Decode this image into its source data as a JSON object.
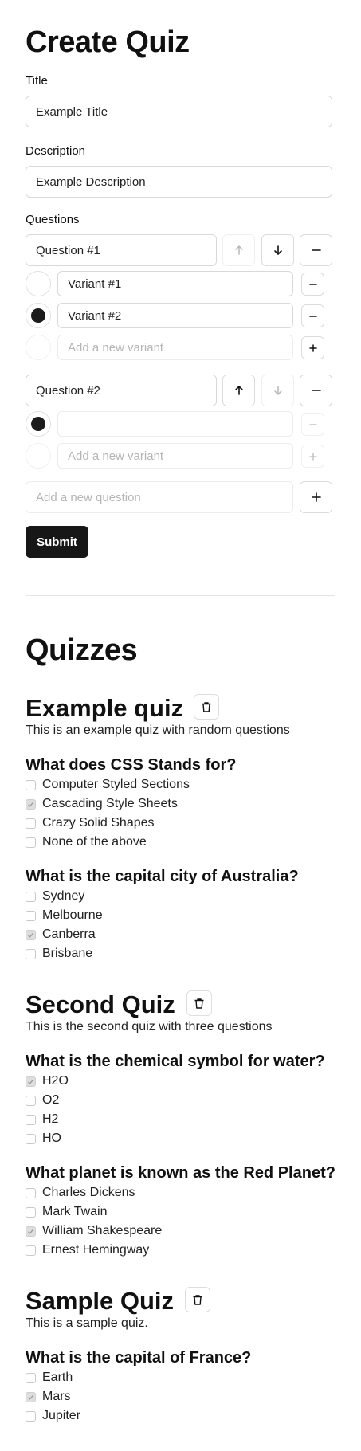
{
  "form": {
    "heading": "Create Quiz",
    "title_label": "Title",
    "title_value": "Example Title",
    "description_label": "Description",
    "description_value": "Example Description",
    "questions_label": "Questions",
    "questions": [
      {
        "value": "Question #1",
        "variants": [
          {
            "value": "Variant #1",
            "selected": false
          },
          {
            "value": "Variant #2",
            "selected": true
          }
        ],
        "new_variant_placeholder": "Add a new variant"
      },
      {
        "value": "Question #2",
        "variants": [
          {
            "value": "",
            "selected": true
          }
        ],
        "new_variant_placeholder": "Add a new variant"
      }
    ],
    "new_question_placeholder": "Add a new question",
    "submit_label": "Submit"
  },
  "quizzes": {
    "heading": "Quizzes",
    "items": [
      {
        "title": "Example quiz",
        "description": "This is an example quiz with random questions",
        "questions": [
          {
            "text": "What does CSS Stands for?",
            "options": [
              {
                "label": "Computer Styled Sections",
                "checked": false
              },
              {
                "label": "Cascading Style Sheets",
                "checked": true
              },
              {
                "label": "Crazy Solid Shapes",
                "checked": false
              },
              {
                "label": "None of the above",
                "checked": false
              }
            ]
          },
          {
            "text": "What is the capital city of Australia?",
            "options": [
              {
                "label": "Sydney",
                "checked": false
              },
              {
                "label": "Melbourne",
                "checked": false
              },
              {
                "label": "Canberra",
                "checked": true
              },
              {
                "label": "Brisbane",
                "checked": false
              }
            ]
          }
        ]
      },
      {
        "title": "Second Quiz",
        "description": "This is the second quiz with three questions",
        "questions": [
          {
            "text": "What is the chemical symbol for water?",
            "options": [
              {
                "label": "H2O",
                "checked": true
              },
              {
                "label": "O2",
                "checked": false
              },
              {
                "label": "H2",
                "checked": false
              },
              {
                "label": "HO",
                "checked": false
              }
            ]
          },
          {
            "text": "What planet is known as the Red Planet?",
            "options": [
              {
                "label": "Charles Dickens",
                "checked": false
              },
              {
                "label": "Mark Twain",
                "checked": false
              },
              {
                "label": "William Shakespeare",
                "checked": true
              },
              {
                "label": "Ernest Hemingway",
                "checked": false
              }
            ]
          }
        ]
      },
      {
        "title": "Sample Quiz",
        "description": "This is a sample quiz.",
        "questions": [
          {
            "text": "What is the capital of France?",
            "options": [
              {
                "label": "Earth",
                "checked": false
              },
              {
                "label": "Mars",
                "checked": true
              },
              {
                "label": "Jupiter",
                "checked": false
              }
            ]
          }
        ]
      }
    ]
  },
  "colors": {
    "accent": "#171717",
    "border": "#d9d9d9",
    "checked_fill": "#dedede"
  }
}
